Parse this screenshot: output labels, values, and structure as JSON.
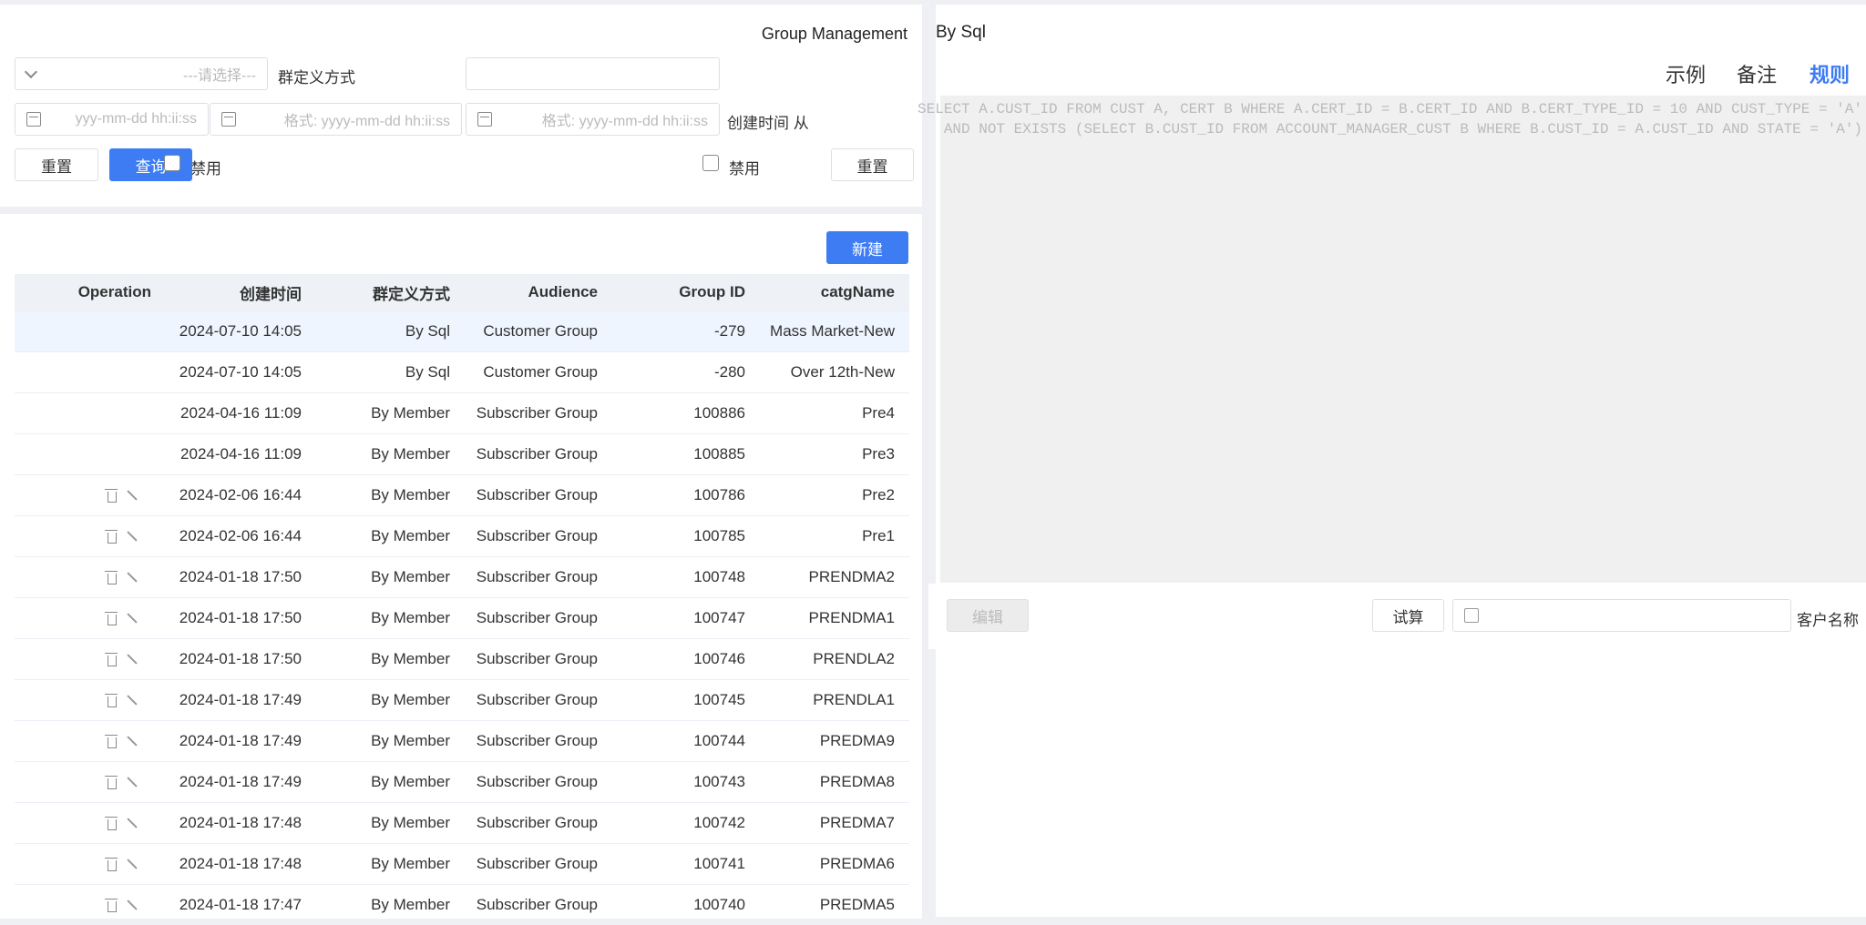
{
  "filters": {
    "title": "Group Management",
    "define_label": "群定义方式",
    "select_placeholder": "---请选择---",
    "created_from_label": "创建时间 从",
    "date_placeholder": "格式: yyyy-mm-dd hh:ii:ss",
    "date_placeholder_short": "yyy-mm-dd hh:ii:ss",
    "reset_label": "重置",
    "query_label": "查询",
    "disable_label": "禁用"
  },
  "table": {
    "new_button": "新建",
    "headers": [
      "catgName",
      "Group ID",
      "Audience",
      "群定义方式",
      "创建时间",
      "Operation"
    ],
    "rows": [
      {
        "name": "Mass Market-New",
        "id": "-279",
        "audience": "Customer Group",
        "def": "By Sql",
        "time": "2024-07-10 14:05",
        "actions": false
      },
      {
        "name": "Over 12th-New",
        "id": "-280",
        "audience": "Customer Group",
        "def": "By Sql",
        "time": "2024-07-10 14:05",
        "actions": false
      },
      {
        "name": "Pre4",
        "id": "100886",
        "audience": "Subscriber Group",
        "def": "By Member",
        "time": "2024-04-16 11:09",
        "actions": false
      },
      {
        "name": "Pre3",
        "id": "100885",
        "audience": "Subscriber Group",
        "def": "By Member",
        "time": "2024-04-16 11:09",
        "actions": false
      },
      {
        "name": "Pre2",
        "id": "100786",
        "audience": "Subscriber Group",
        "def": "By Member",
        "time": "2024-02-06 16:44",
        "actions": true
      },
      {
        "name": "Pre1",
        "id": "100785",
        "audience": "Subscriber Group",
        "def": "By Member",
        "time": "2024-02-06 16:44",
        "actions": true
      },
      {
        "name": "PRENDMA2",
        "id": "100748",
        "audience": "Subscriber Group",
        "def": "By Member",
        "time": "2024-01-18 17:50",
        "actions": true
      },
      {
        "name": "PRENDMA1",
        "id": "100747",
        "audience": "Subscriber Group",
        "def": "By Member",
        "time": "2024-01-18 17:50",
        "actions": true
      },
      {
        "name": "PRENDLA2",
        "id": "100746",
        "audience": "Subscriber Group",
        "def": "By Member",
        "time": "2024-01-18 17:50",
        "actions": true
      },
      {
        "name": "PRENDLA1",
        "id": "100745",
        "audience": "Subscriber Group",
        "def": "By Member",
        "time": "2024-01-18 17:49",
        "actions": true
      },
      {
        "name": "PREDMA9",
        "id": "100744",
        "audience": "Subscriber Group",
        "def": "By Member",
        "time": "2024-01-18 17:49",
        "actions": true
      },
      {
        "name": "PREDMA8",
        "id": "100743",
        "audience": "Subscriber Group",
        "def": "By Member",
        "time": "2024-01-18 17:49",
        "actions": true
      },
      {
        "name": "PREDMA7",
        "id": "100742",
        "audience": "Subscriber Group",
        "def": "By Member",
        "time": "2024-01-18 17:48",
        "actions": true
      },
      {
        "name": "PREDMA6",
        "id": "100741",
        "audience": "Subscriber Group",
        "def": "By Member",
        "time": "2024-01-18 17:48",
        "actions": true
      },
      {
        "name": "PREDMA5",
        "id": "100740",
        "audience": "Subscriber Group",
        "def": "By Member",
        "time": "2024-01-18 17:47",
        "actions": true
      }
    ]
  },
  "rule_panel": {
    "by_sql": "By Sql",
    "tabs": [
      "规则",
      "备注",
      "示例"
    ],
    "sql_lines": [
      "SELECT A.CUST_ID FROM CUST A, CERT B WHERE A.CERT_ID = B.CERT_ID AND B.CERT_TYPE_ID = 10 AND CUST_TYPE = 'A'",
      "AND NOT EXISTS (SELECT B.CUST_ID FROM ACCOUNT_MANAGER_CUST B WHERE B.CUST_ID = A.CUST_ID AND STATE = 'A')"
    ],
    "customer_name_label": "客户名称",
    "calc_button": "试算",
    "edit_button": "编辑"
  }
}
